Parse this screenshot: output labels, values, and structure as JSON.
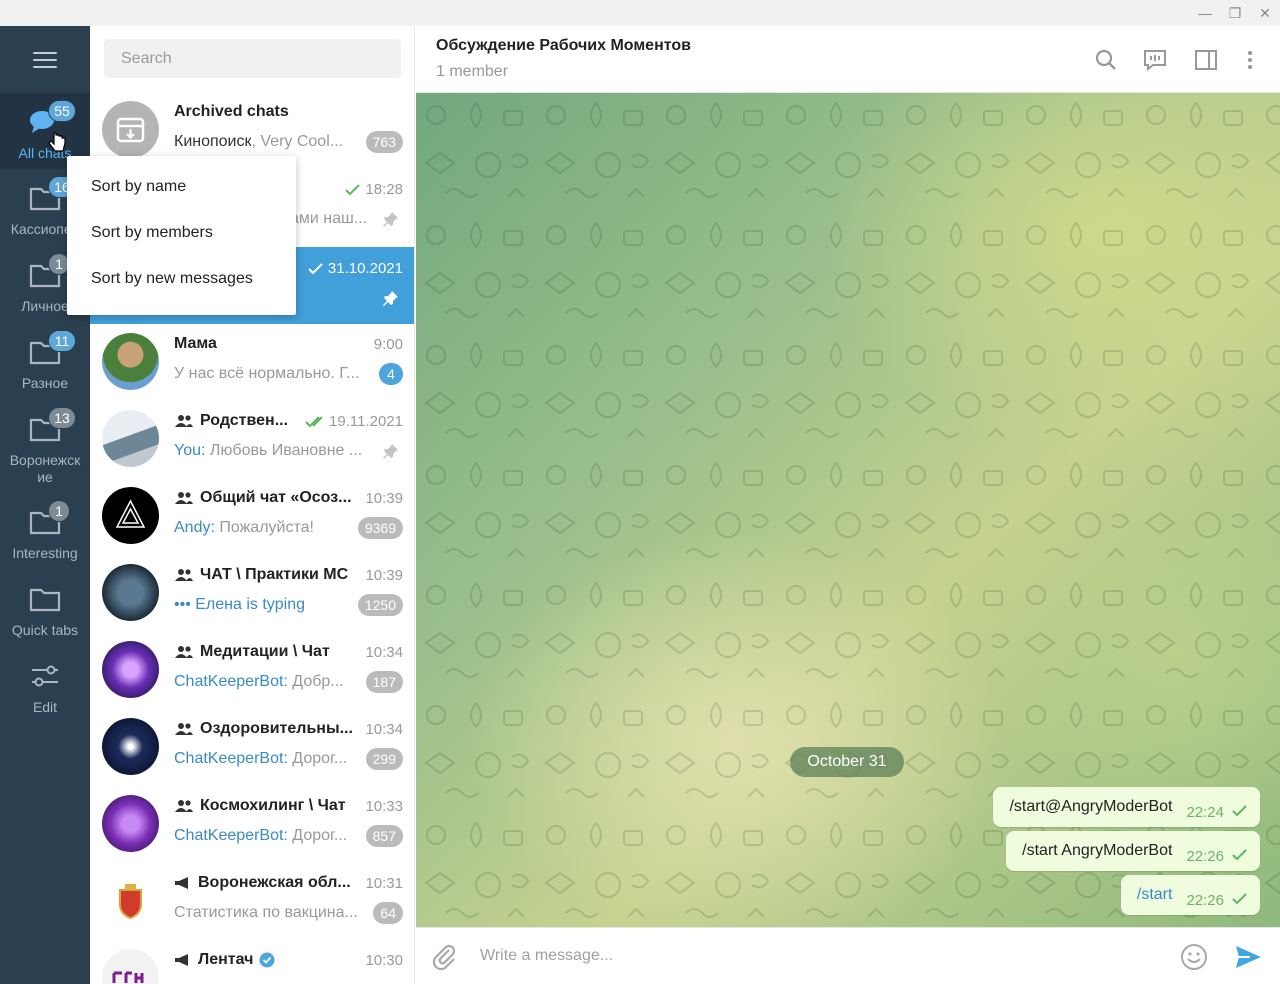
{
  "window": {
    "minimize": "—",
    "restore": "❐",
    "close": "✕"
  },
  "folders": [
    {
      "label": "All chats",
      "badge": "55",
      "active": true
    },
    {
      "label": "Кассиопея",
      "badge": "16"
    },
    {
      "label": "Личное",
      "badge": "1"
    },
    {
      "label": "Разное",
      "badge": "11"
    },
    {
      "label": "Воронежские",
      "badge": "13"
    },
    {
      "label": "Interesting",
      "badge": "1"
    },
    {
      "label": "Quick tabs",
      "badge": ""
    },
    {
      "label": "Edit",
      "badge": ""
    }
  ],
  "search": {
    "placeholder": "Search"
  },
  "chats": [
    {
      "name": "Archived chats",
      "preview_who": "Кинопоиск",
      "preview": ", Very Cool...",
      "badge": "763"
    },
    {
      "time": "18:28",
      "preview": "ами наш..."
    },
    {
      "time": "31.10.2021"
    },
    {
      "name": "Мама",
      "time": "9:00",
      "preview": "У нас всё нормально.  Г...",
      "badge": "4"
    },
    {
      "name": "Родствен...",
      "time": "19.11.2021",
      "preview_who": "You:",
      "preview": " Любовь Ивановне ..."
    },
    {
      "name": "Общий чат «Осоз...",
      "time": "10:39",
      "preview_who": "Andy:",
      "preview": " Пожалуйста!",
      "badge": "9369"
    },
    {
      "name": "ЧАТ \\ Практики МС",
      "time": "10:39",
      "preview_who": "••• Елена is typing",
      "preview": "",
      "badge": "1250"
    },
    {
      "name": "Медитации \\ Чат",
      "time": "10:34",
      "preview_who": "ChatKeeperBot:",
      "preview": " Добр...",
      "badge": "187"
    },
    {
      "name": "Оздоровительны...",
      "time": "10:34",
      "preview_who": "ChatKeeperBot:",
      "preview": " Дорог...",
      "badge": "299"
    },
    {
      "name": "Космохилинг \\ Чат",
      "time": "10:33",
      "preview_who": "ChatKeeperBot:",
      "preview": " Дорог...",
      "badge": "857"
    },
    {
      "name": "Воронежская обл...",
      "time": "10:31",
      "preview": "Статистика по вакцина...",
      "badge": "64"
    },
    {
      "name": "Лентач",
      "time": "10:30"
    }
  ],
  "sort_menu": [
    "Sort by name",
    "Sort by members",
    "Sort by new messages"
  ],
  "header": {
    "title": "Обсуждение Рабочих Моментов",
    "subtitle": "1 member"
  },
  "date_pill": "October 31",
  "messages": [
    {
      "text": "/start@AngryModerBot",
      "time": "22:24"
    },
    {
      "text": "/start AngryModerBot",
      "time": "22:26"
    },
    {
      "text": "/start",
      "time": "22:26"
    }
  ],
  "composer": {
    "placeholder": "Write a message..."
  },
  "colors": {
    "sidebar": "#2a3f50",
    "accent": "#419fd9",
    "bubble": "#effdde"
  }
}
